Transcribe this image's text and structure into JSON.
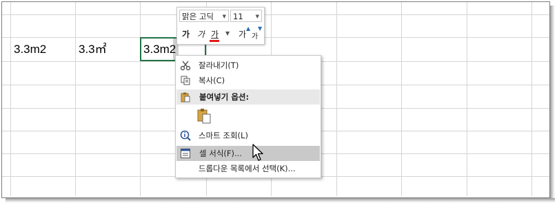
{
  "sheet": {
    "cells": [
      "3.3m2",
      "3.3㎡",
      "3.3m2"
    ]
  },
  "mini_toolbar": {
    "font_name": "맑은 고딕",
    "font_size": "11",
    "buttons": [
      "가",
      "가",
      "가",
      "가",
      "가"
    ]
  },
  "context_menu": {
    "items": [
      {
        "label": "잘라내기(T)",
        "icon": "scissors-icon"
      },
      {
        "label": "복사(C)",
        "icon": "copy-icon"
      },
      {
        "label": "붙여넣기 옵션:",
        "icon": "paste-icon"
      },
      {
        "label": "스마트 조회(L)",
        "icon": "smart-lookup-icon"
      },
      {
        "label": "셀 서식(F)...",
        "icon": "format-cells-icon"
      },
      {
        "label": "드롭다운 목록에서 선택(K)...",
        "icon": ""
      }
    ]
  },
  "colors": {
    "selection": "#217346",
    "gridline": "#d4d4d4",
    "hover": "#c9c9c9"
  }
}
